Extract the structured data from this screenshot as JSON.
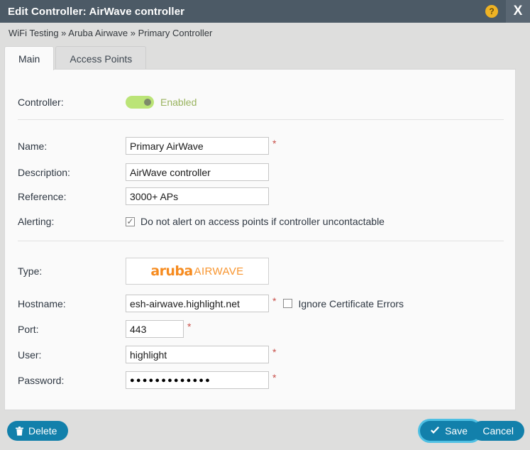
{
  "window": {
    "title": "Edit Controller: AirWave controller",
    "help_icon": "question-mark-icon",
    "close_label": "X"
  },
  "breadcrumb": {
    "text": "WiFi Testing » Aruba Airwave » Primary Controller"
  },
  "tabs": [
    {
      "label": "Main",
      "active": true
    },
    {
      "label": "Access Points",
      "active": false
    }
  ],
  "form": {
    "controller": {
      "label": "Controller:",
      "toggle_state": "on",
      "state_label": "Enabled"
    },
    "name": {
      "label": "Name:",
      "value": "Primary AirWave",
      "placeholder": "",
      "required": "*"
    },
    "description": {
      "label": "Description:",
      "value": "AirWave controller",
      "placeholder": ""
    },
    "reference": {
      "label": "Reference:",
      "value": "3000+ APs",
      "placeholder": ""
    },
    "alerting": {
      "label": "Alerting:",
      "checkbox_checked": true,
      "checkbox_text": "Do not alert on access points if controller uncontactable"
    },
    "type": {
      "label": "Type:",
      "logo_primary": "aruba",
      "logo_secondary": "AIRWAVE"
    },
    "hostname": {
      "label": "Hostname:",
      "value": "esh-airwave.highlight.net",
      "placeholder": "",
      "required": "*",
      "ignore_cert_checked": false,
      "ignore_cert_text": "Ignore Certificate Errors"
    },
    "port": {
      "label": "Port:",
      "value": "443",
      "placeholder": "",
      "required": "*"
    },
    "user": {
      "label": "User:",
      "value": "highlight",
      "placeholder": "",
      "required": "*"
    },
    "password": {
      "label": "Password:",
      "value": "●●●●●●●●●●●●●",
      "placeholder": "",
      "required": "*"
    }
  },
  "footer": {
    "delete_label": "Delete",
    "save_label": "Save",
    "cancel_label": "Cancel"
  },
  "colors": {
    "titlebar": "#4c5a66",
    "accent_blue": "#1280ab",
    "focus_ring": "#4fc0e3",
    "toggle_green": "#bbe477",
    "enabled_text": "#99b35e",
    "required_red": "#c8504a",
    "logo_orange": "#f68b1f",
    "help_yellow": "#efb324"
  }
}
